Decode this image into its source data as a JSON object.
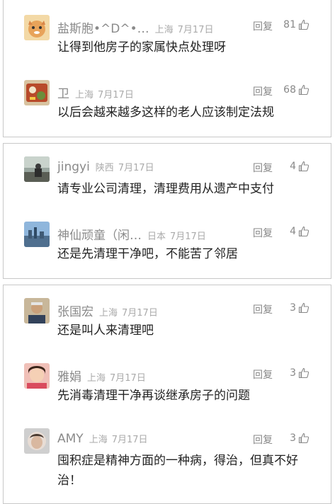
{
  "cards": [
    {
      "comments": [
        {
          "name": "盐斯胞•^D^•…",
          "location": "上海",
          "date": "7月17日",
          "reply": "回复",
          "likes": "81",
          "text": "让得到他房子的家属快点处理呀",
          "avatar": "cartoon-fox"
        },
        {
          "name": "卫",
          "location": "上海",
          "date": "7月17日",
          "reply": "回复",
          "likes": "68",
          "text": "以后会越来越多这样的老人应该制定法规",
          "avatar": "food-photo"
        }
      ]
    },
    {
      "comments": [
        {
          "name": "jingyi",
          "location": "陕西",
          "date": "7月17日",
          "reply": "回复",
          "likes": "4",
          "text": "请专业公司清理，清理费用从遗产中支付",
          "avatar": "street-photo"
        },
        {
          "name": "神仙顽童（闲…",
          "location": "日本",
          "date": "7月17日",
          "reply": "回复",
          "likes": "4",
          "text": "还是先清理干净吧，不能苦了邻居",
          "avatar": "city-photo"
        }
      ]
    },
    {
      "comments": [
        {
          "name": "张国宏",
          "location": "上海",
          "date": "7月17日",
          "reply": "回复",
          "likes": "3",
          "text": "还是叫人来清理吧",
          "avatar": "man-portrait"
        },
        {
          "name": "雅娟",
          "location": "上海",
          "date": "7月17日",
          "reply": "回复",
          "likes": "3",
          "text": "先消毒清理干净再谈继承房子的问题",
          "avatar": "woman-portrait"
        },
        {
          "name": "AMY",
          "location": "上海",
          "date": "7月17日",
          "reply": "回复",
          "likes": "3",
          "text": "囤积症是精神方面的一种病，得治，但真不好治！",
          "avatar": "woman-portrait-2"
        }
      ]
    }
  ],
  "colors": {
    "name": "#8a8a8a",
    "meta": "#aaaaaa",
    "text": "#222222",
    "border": "#c8c8c8"
  }
}
